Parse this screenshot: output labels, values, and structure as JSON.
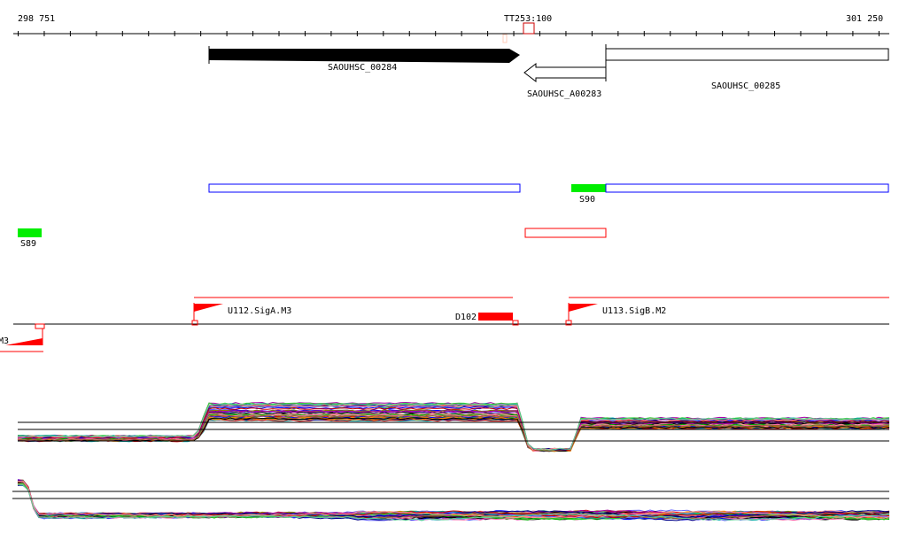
{
  "ruler": {
    "start_label": "298 751",
    "end_label": "301 250",
    "marker_label": "TT253:100"
  },
  "genes": [
    {
      "label": "SAOUHSC_00284",
      "strand": "+",
      "style": "filled"
    },
    {
      "label": "SAOUHSC_A00283",
      "strand": "-",
      "style": "open"
    },
    {
      "label": "SAOUHSC_00285",
      "strand": "+",
      "style": "open"
    }
  ],
  "features": {
    "s90": "S90",
    "s89": "S89"
  },
  "regulatory": {
    "left_partial": "M3",
    "u112": "U112.SigA.M3",
    "d102": "D102",
    "u113": "U113.SigB.M2"
  },
  "colors": {
    "accent_red": "#ff0000",
    "feature_green": "#00ee00",
    "feature_blue": "#0000ff"
  },
  "trace_colors": [
    "#ff0000",
    "#00aa00",
    "#0000ff",
    "#ff8800",
    "#aa00aa",
    "#00aaaa",
    "#888800",
    "#ff66aa",
    "#6666ff",
    "#996633",
    "#33cc33",
    "#cc0000",
    "#000088",
    "#ff9999",
    "#66cc99"
  ]
}
